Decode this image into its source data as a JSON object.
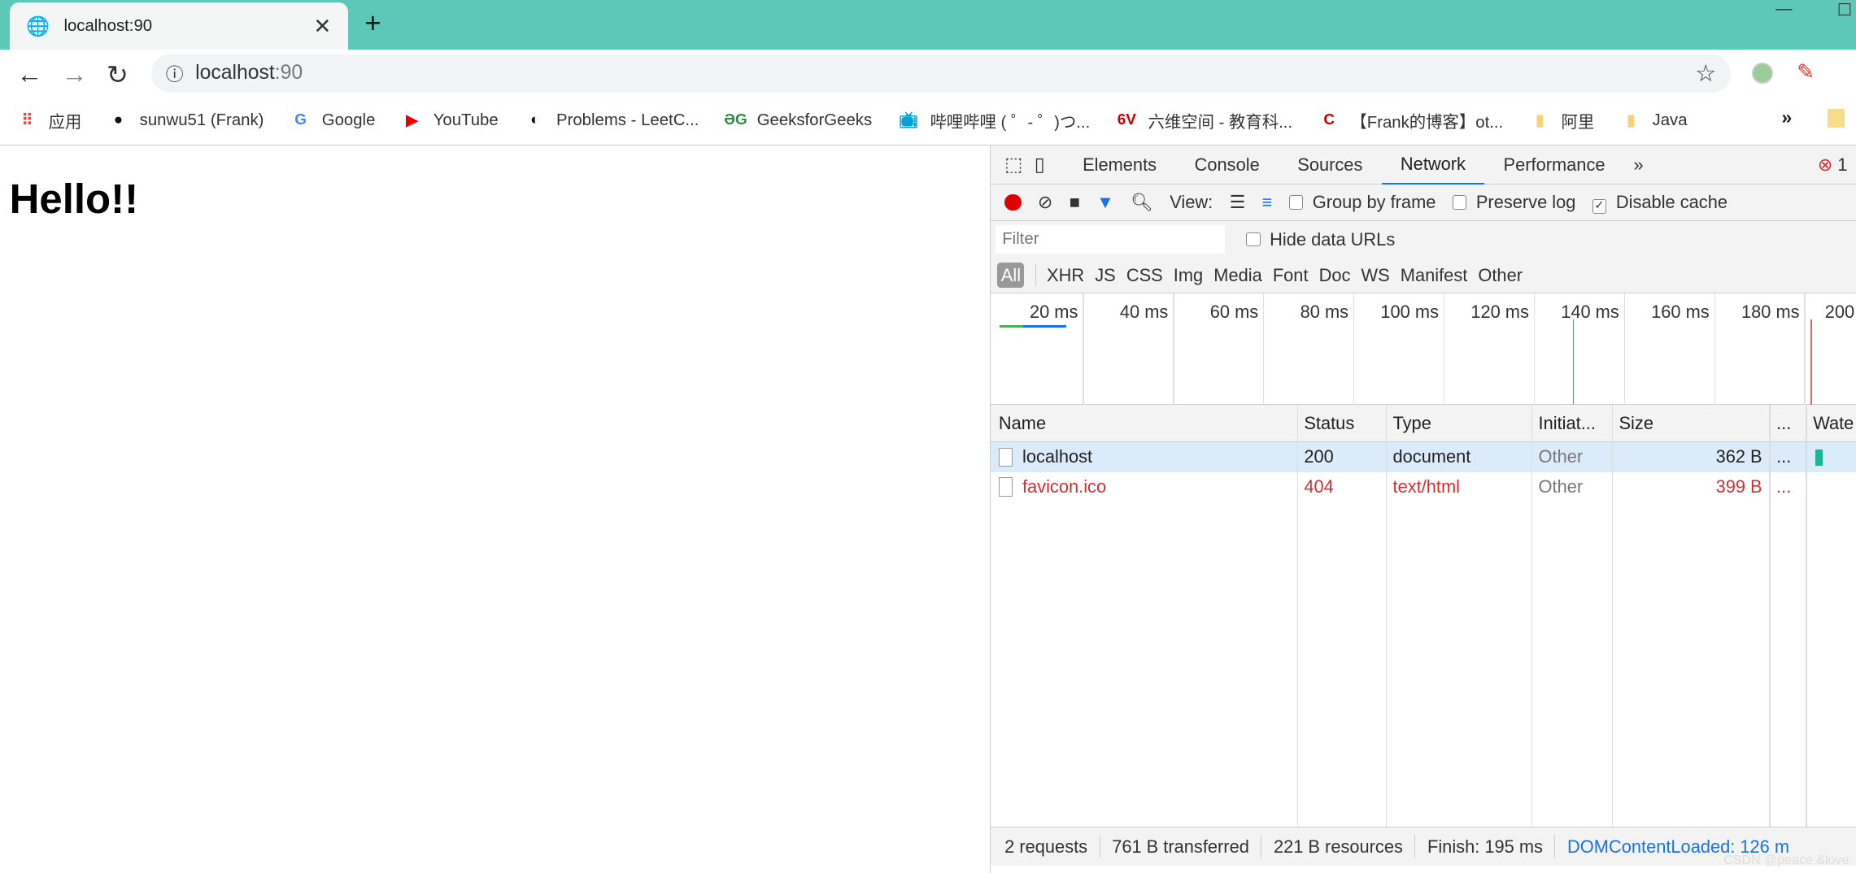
{
  "browser": {
    "tab_title": "localhost:90",
    "url_host": "localhost",
    "url_port": ":90",
    "accent_color": "#5ec8b8"
  },
  "bookmarks": [
    {
      "label": "应用",
      "icon": "apps-grid-icon"
    },
    {
      "label": "sunwu51 (Frank)",
      "icon": "github-icon"
    },
    {
      "label": "Google",
      "icon": "google-icon"
    },
    {
      "label": "YouTube",
      "icon": "youtube-icon"
    },
    {
      "label": "Problems - LeetC...",
      "icon": "globe-icon"
    },
    {
      "label": "GeeksforGeeks",
      "icon": "gfg-icon"
    },
    {
      "label": "哔哩哔哩 ( ゜- ゜)つ...",
      "icon": "bilibili-icon"
    },
    {
      "label": "六维空间 - 教育科...",
      "icon": "6v-icon"
    },
    {
      "label": "【Frank的博客】ot...",
      "icon": "csdn-icon"
    },
    {
      "label": "阿里",
      "icon": "folder-icon"
    },
    {
      "label": "Java",
      "icon": "folder-icon"
    }
  ],
  "page": {
    "heading": "Hello!!"
  },
  "devtools": {
    "tabs": [
      "Elements",
      "Console",
      "Sources",
      "Network",
      "Performance"
    ],
    "active_tab": "Network",
    "more": "»",
    "error_count": "1",
    "toolbar": {
      "view_label": "View:",
      "group_by_frame": "Group by frame",
      "preserve_log": "Preserve log",
      "disable_cache": "Disable cache",
      "disable_cache_checked": true
    },
    "filter_placeholder": "Filter",
    "hide_data_urls": "Hide data URLs",
    "types": [
      "All",
      "XHR",
      "JS",
      "CSS",
      "Img",
      "Media",
      "Font",
      "Doc",
      "WS",
      "Manifest",
      "Other"
    ],
    "timeline_ticks": [
      "20 ms",
      "40 ms",
      "60 ms",
      "80 ms",
      "100 ms",
      "120 ms",
      "140 ms",
      "160 ms",
      "180 ms",
      "200"
    ],
    "columns": [
      "Name",
      "Status",
      "Type",
      "Initiat...",
      "Size",
      "...",
      "Wate"
    ],
    "rows": [
      {
        "name": "localhost",
        "status": "200",
        "type": "document",
        "initiator": "Other",
        "size": "362 B",
        "more": "...",
        "error": false
      },
      {
        "name": "favicon.ico",
        "status": "404",
        "type": "text/html",
        "initiator": "Other",
        "size": "399 B",
        "more": "...",
        "error": true
      }
    ],
    "footer": {
      "requests": "2 requests",
      "transferred": "761 B transferred",
      "resources": "221 B resources",
      "finish": "Finish: 195 ms",
      "dcl": "DOMContentLoaded: 126 m"
    }
  },
  "watermark": "CSDN @peace &love"
}
